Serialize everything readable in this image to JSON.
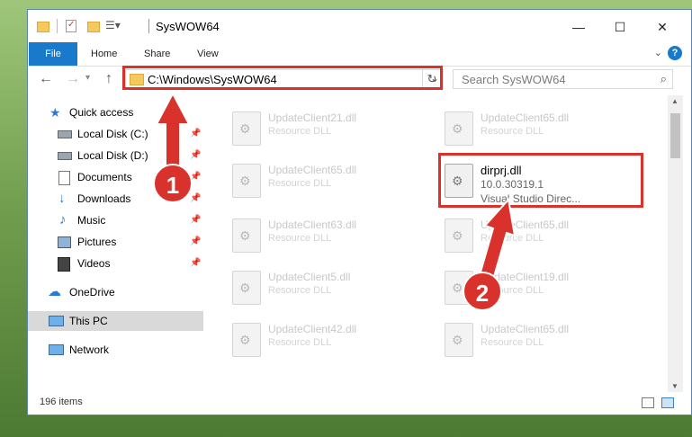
{
  "window": {
    "title": "SysWOW64"
  },
  "window_controls": {
    "minimize": "—",
    "maximize": "☐",
    "close": "✕"
  },
  "ribbon": {
    "file": "File",
    "home": "Home",
    "share": "Share",
    "view": "View",
    "help": "?"
  },
  "address": {
    "path": "C:\\Windows\\SysWOW64"
  },
  "search": {
    "placeholder": "Search SysWOW64"
  },
  "sidebar": {
    "items": [
      {
        "label": "Quick access"
      },
      {
        "label": "Local Disk (C:)"
      },
      {
        "label": "Local Disk (D:)"
      },
      {
        "label": "Documents"
      },
      {
        "label": "Downloads"
      },
      {
        "label": "Music"
      },
      {
        "label": "Pictures"
      },
      {
        "label": "Videos"
      },
      {
        "label": "OneDrive"
      },
      {
        "label": "This PC"
      },
      {
        "label": "Network"
      }
    ]
  },
  "files": {
    "left": [
      {
        "name": "UpdateClient21.dll",
        "type": "Resource DLL"
      },
      {
        "name": "UpdateClient65.dll",
        "type": "Resource DLL"
      },
      {
        "name": "UpdateClient63.dll",
        "type": "Resource DLL"
      },
      {
        "name": "UpdateClient5.dll",
        "type": "Resource DLL"
      },
      {
        "name": "UpdateClient42.dll",
        "type": "Resource DLL"
      }
    ],
    "right": [
      {
        "name": "UpdateClient65.dll",
        "type": "Resource DLL"
      },
      {
        "name": "UpdateClient65.dll",
        "type": "Resource DLL"
      },
      {
        "name": "UpdateClient19.dll",
        "type": "Resource DLL"
      },
      {
        "name": "UpdateClient65.dll",
        "type": "Resource DLL"
      }
    ],
    "highlighted": {
      "name": "dirprj.dll",
      "version": "10.0.30319.1",
      "description": "Visual Studio Direc..."
    }
  },
  "status": {
    "items_count": "196 items"
  },
  "annotations": {
    "step1": "1",
    "step2": "2",
    "color": "#d9322c"
  }
}
